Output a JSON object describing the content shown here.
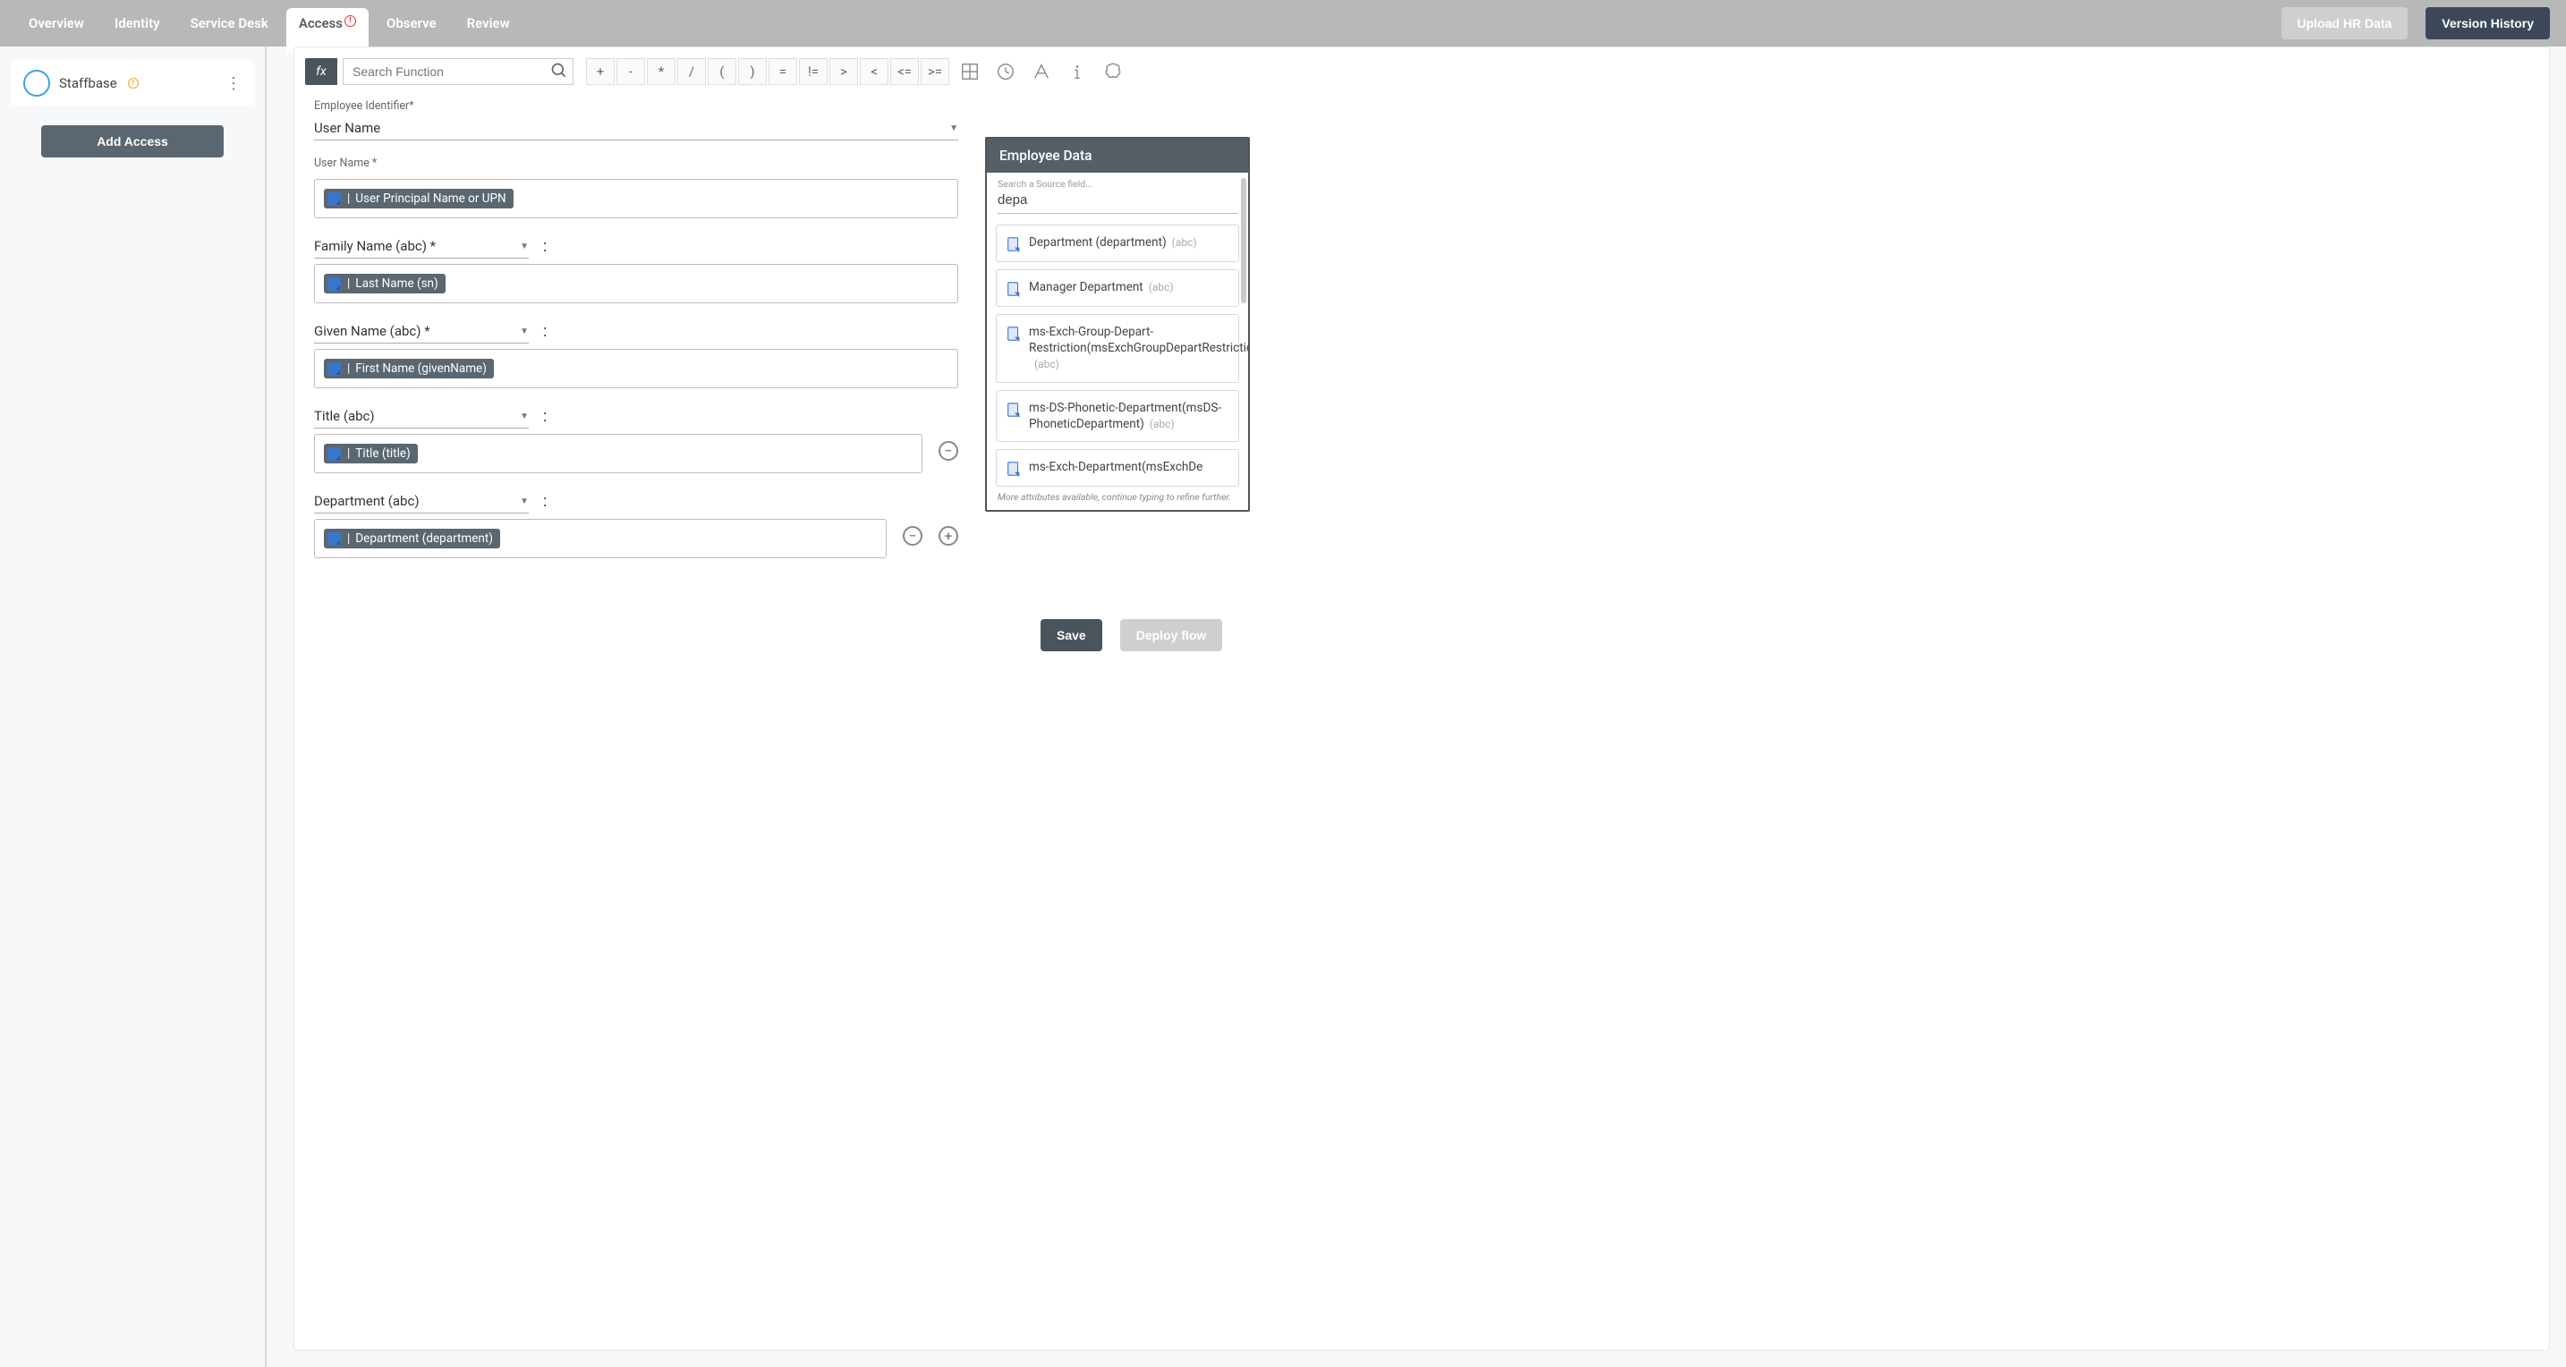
{
  "nav": {
    "tabs": [
      "Overview",
      "Identity",
      "Service Desk",
      "Access",
      "Observe",
      "Review"
    ],
    "active_index": 3,
    "alert_tab_index": 3,
    "upload_btn": "Upload HR Data",
    "version_btn": "Version History"
  },
  "sidebar": {
    "app_name": "Staffbase",
    "add_access_btn": "Add Access"
  },
  "fx": {
    "badge": "fx",
    "search_placeholder": "Search Function",
    "operators": [
      "+",
      "-",
      "*",
      "/",
      "(",
      ")",
      "=",
      "!=",
      ">",
      "<",
      "<=",
      ">="
    ]
  },
  "fields": {
    "employee_identifier": {
      "label": "Employee Identifier*",
      "value": "User Name"
    },
    "rows": [
      {
        "label": "User Name *",
        "chip": "User Principal Name or UPN",
        "has_select": false,
        "removable": false,
        "addable": false
      },
      {
        "label": "Family Name (abc) *",
        "chip": "Last Name (sn)",
        "has_select": true,
        "removable": false,
        "addable": false
      },
      {
        "label": "Given Name (abc) *",
        "chip": "First Name (givenName)",
        "has_select": true,
        "removable": false,
        "addable": false
      },
      {
        "label": "Title (abc)",
        "chip": "Title (title)",
        "has_select": true,
        "removable": true,
        "addable": false
      },
      {
        "label": "Department (abc)",
        "chip": "Department (department)",
        "has_select": true,
        "removable": true,
        "addable": true
      }
    ]
  },
  "emp_panel": {
    "title": "Employee Data",
    "search_label": "Search a Source field...",
    "search_value": "depa",
    "items": [
      {
        "text": "Department (department)",
        "type": "(abc)"
      },
      {
        "text": "Manager Department",
        "type": "(abc)"
      },
      {
        "text": "ms-Exch-Group-Depart-Restriction(msExchGroupDepartRestriction)",
        "type": "(abc)"
      },
      {
        "text": "ms-DS-Phonetic-Department(msDS-PhoneticDepartment)",
        "type": "(abc)"
      },
      {
        "text": "ms-Exch-Department(msExchDe",
        "type": ""
      }
    ],
    "footer": "More attributes available, continue typing to refine further."
  },
  "footer": {
    "save": "Save",
    "deploy": "Deploy flow"
  },
  "map_colon": ":"
}
